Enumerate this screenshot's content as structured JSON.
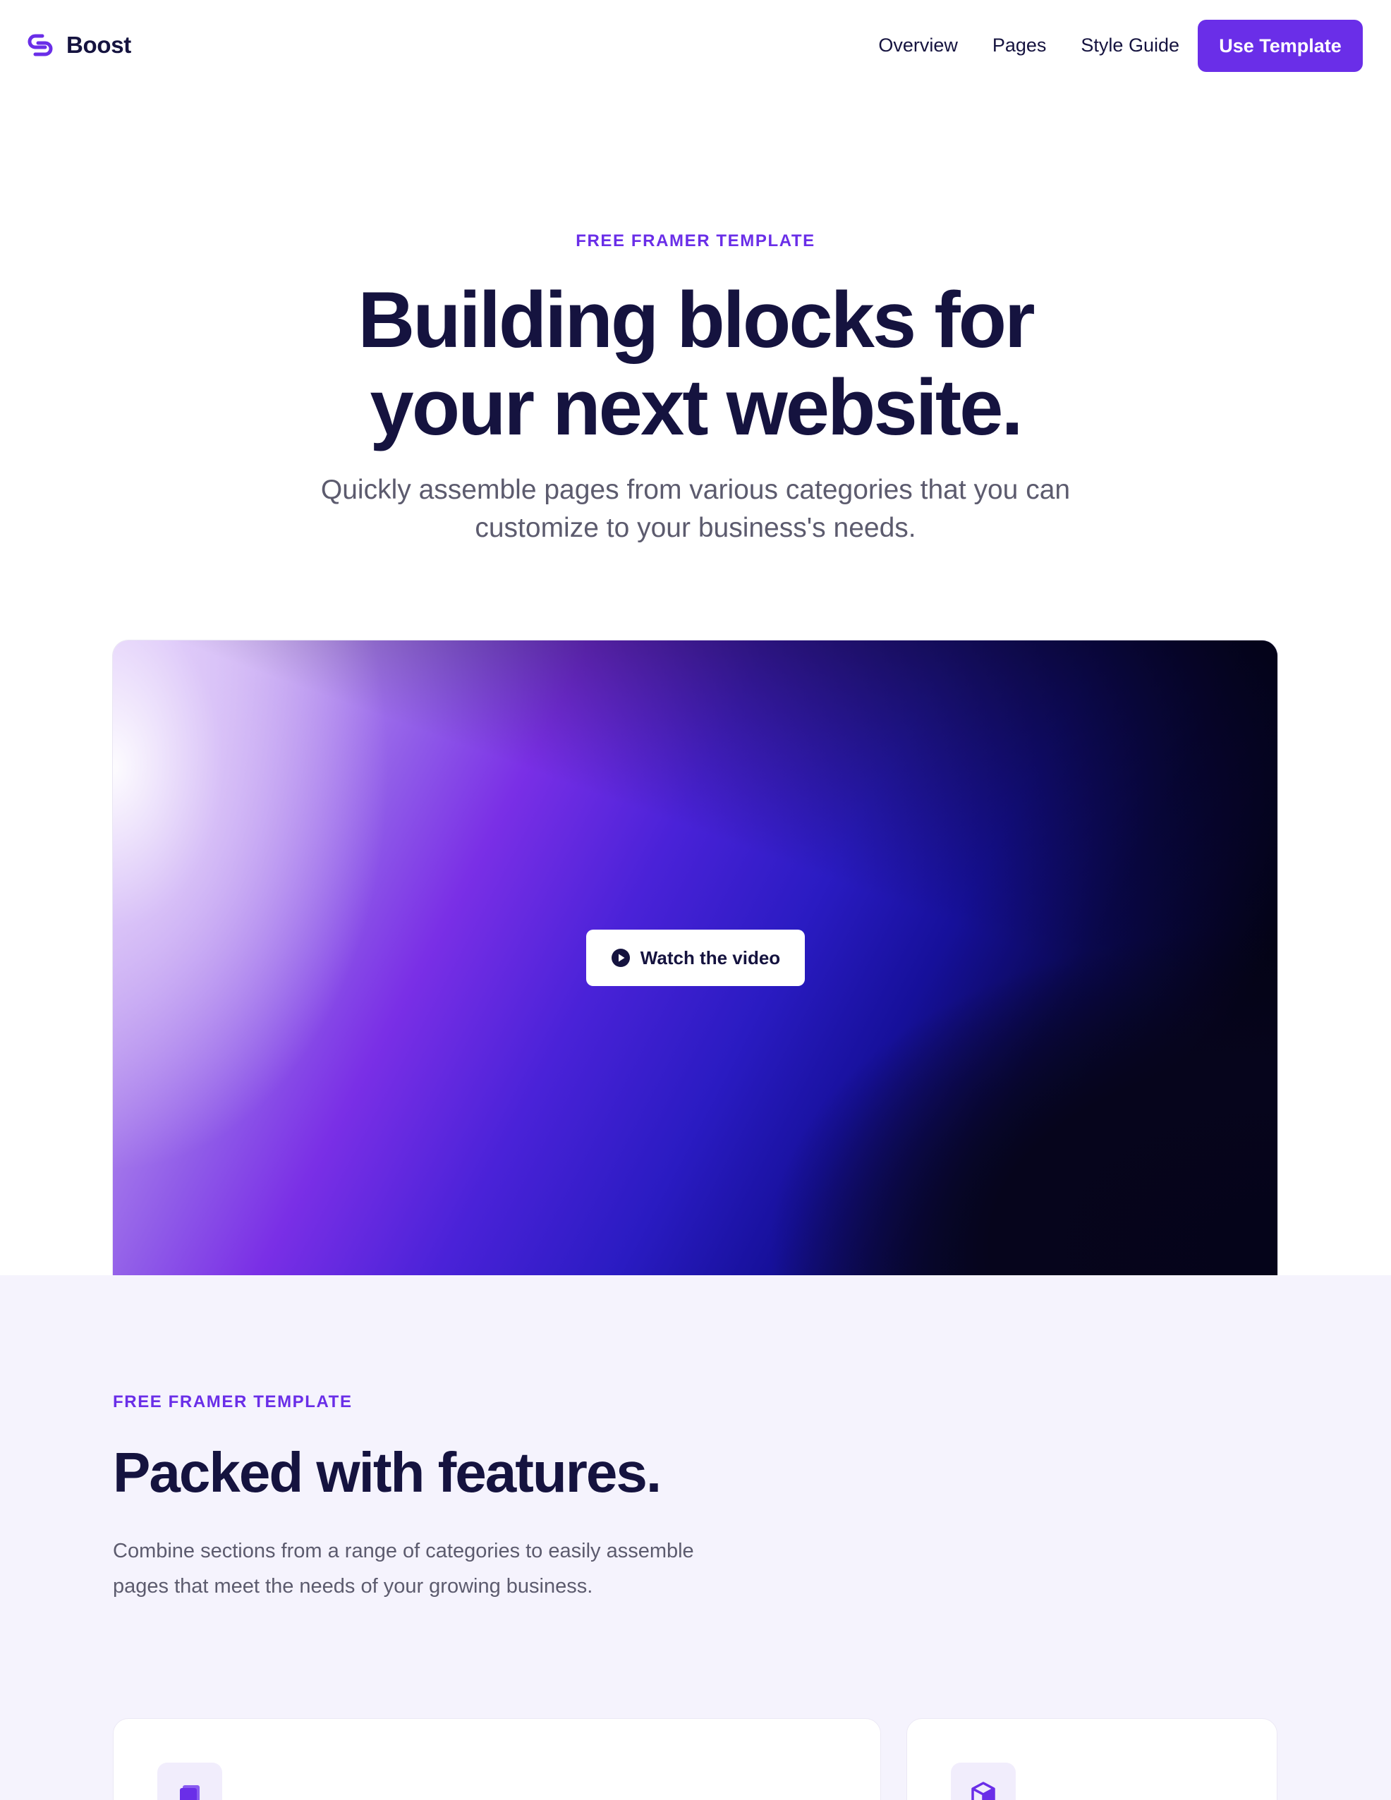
{
  "brand": {
    "name": "Boost",
    "logo_icon": "boost-logo-icon"
  },
  "nav": {
    "links": [
      "Overview",
      "Pages",
      "Style Guide"
    ],
    "cta": "Use Template"
  },
  "hero": {
    "eyebrow": "FREE FRAMER TEMPLATE",
    "title_line1": "Building blocks for",
    "title_line2": "your next website.",
    "subtitle": "Quickly assemble pages from various categories that you can customize to your business's needs.",
    "video_button": "Watch the video",
    "video_icon": "play-circle-icon"
  },
  "features": {
    "eyebrow": "FREE FRAMER TEMPLATE",
    "title": "Packed with features.",
    "subtitle": "Combine sections from a range of categories to easily assemble pages that meet the needs of your growing business.",
    "cards": [
      {
        "icon": "pages-stack-icon"
      },
      {
        "icon": "cube-icon"
      }
    ]
  },
  "colors": {
    "accent": "#6a2ee8",
    "heading": "#15133f",
    "body_text": "#5c5b6e",
    "section_bg": "#f5f3fd"
  }
}
